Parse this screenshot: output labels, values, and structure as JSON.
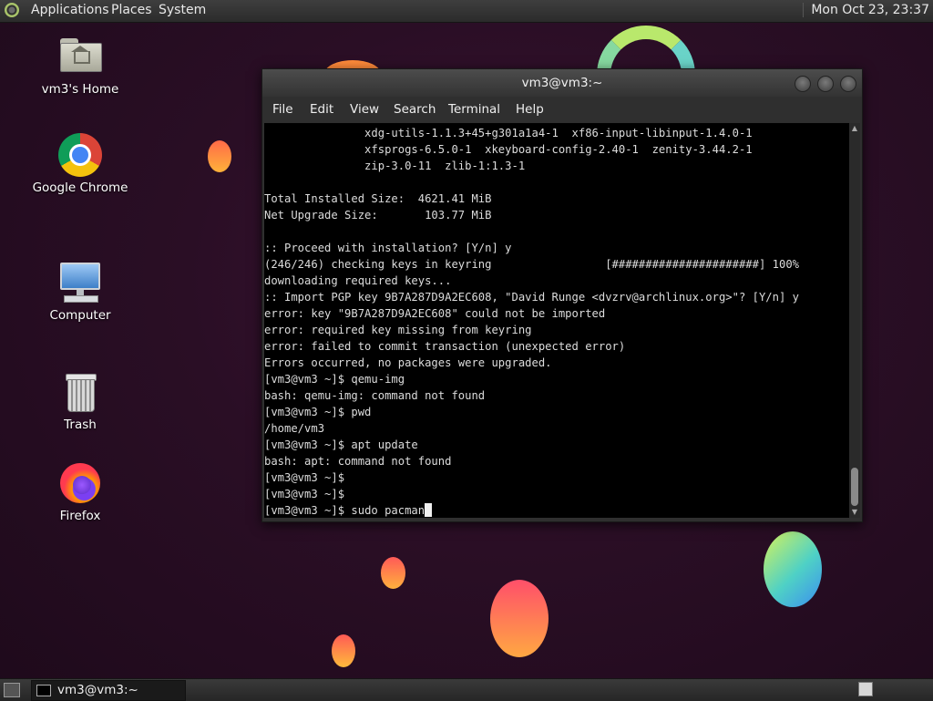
{
  "top_panel": {
    "menus": [
      "Applications",
      "Places",
      "System"
    ],
    "clock": "Mon Oct 23, 23:37"
  },
  "desktop_icons": [
    {
      "label": "vm3's Home",
      "icon": "home-folder-icon"
    },
    {
      "label": "Google Chrome",
      "icon": "chrome-icon"
    },
    {
      "label": "Computer",
      "icon": "computer-icon"
    },
    {
      "label": "Trash",
      "icon": "trash-icon"
    },
    {
      "label": "Firefox",
      "icon": "firefox-icon"
    }
  ],
  "terminal": {
    "title": "vm3@vm3:~",
    "menus": [
      "File",
      "Edit",
      "View",
      "Search",
      "Terminal",
      "Help"
    ],
    "lines": [
      "               xdg-utils-1.1.3+45+g301a1a4-1  xf86-input-libinput-1.4.0-1",
      "               xfsprogs-6.5.0-1  xkeyboard-config-2.40-1  zenity-3.44.2-1",
      "               zip-3.0-11  zlib-1:1.3-1",
      "",
      "Total Installed Size:  4621.41 MiB",
      "Net Upgrade Size:       103.77 MiB",
      "",
      ":: Proceed with installation? [Y/n] y",
      "(246/246) checking keys in keyring                 [######################] 100%",
      "downloading required keys...",
      ":: Import PGP key 9B7A287D9A2EC608, \"David Runge <dvzrv@archlinux.org>\"? [Y/n] y",
      "error: key \"9B7A287D9A2EC608\" could not be imported",
      "error: required key missing from keyring",
      "error: failed to commit transaction (unexpected error)",
      "Errors occurred, no packages were upgraded.",
      "[vm3@vm3 ~]$ qemu-img",
      "bash: qemu-img: command not found",
      "[vm3@vm3 ~]$ pwd",
      "/home/vm3",
      "[vm3@vm3 ~]$ apt update",
      "bash: apt: command not found",
      "[vm3@vm3 ~]$",
      "[vm3@vm3 ~]$"
    ],
    "prompt": "[vm3@vm3 ~]$ ",
    "input": "sudo pacman"
  },
  "taskbar": {
    "window_label": "vm3@vm3:~"
  }
}
